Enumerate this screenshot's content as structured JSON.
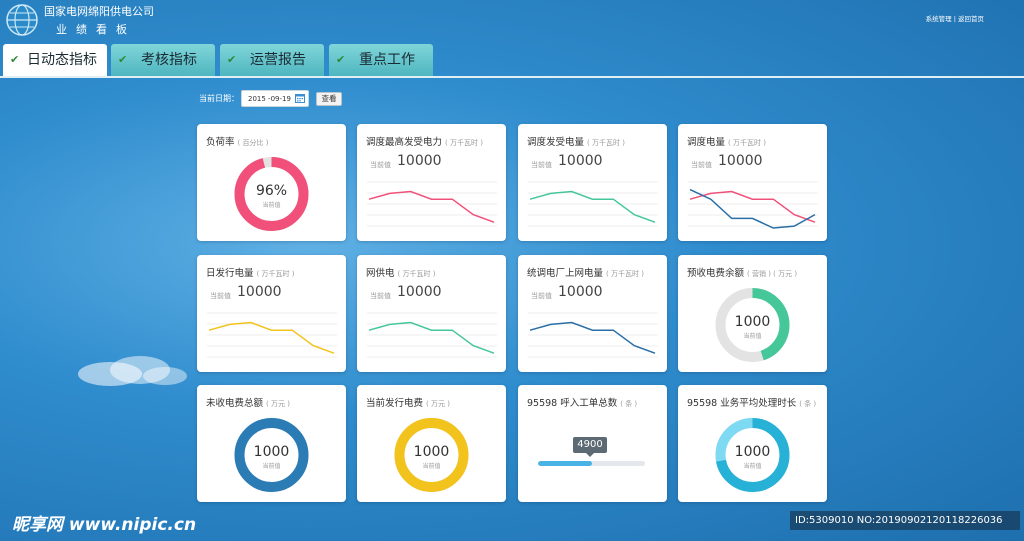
{
  "header": {
    "company": "国家电网绵阳供电公司",
    "subtitle": "业绩看板",
    "links": [
      "系统管理",
      "返回首页"
    ],
    "separator": "|",
    "logo_icon": "globe-logo-icon"
  },
  "tabs": [
    {
      "label": "日动态指标",
      "active": true
    },
    {
      "label": "考核指标",
      "active": false
    },
    {
      "label": "运营报告",
      "active": false
    },
    {
      "label": "重点工作",
      "active": false
    }
  ],
  "date_filter": {
    "label": "当前日期：",
    "value": "2015 -09-19",
    "button": "查看"
  },
  "colors": {
    "pink": "#f0507a",
    "teal": "#45c79a",
    "navy": "#2a6ea6",
    "yellow": "#f2c31c",
    "gray": "#e3e3e3",
    "blue": "#2b7bb5",
    "light_blue": "#4ab3e5",
    "cyan_dark": "#27b1d6",
    "cyan_light": "#7ddaf2"
  },
  "cards": [
    {
      "title": "负荷率",
      "unit": "( 百分比 )",
      "type": "donut",
      "value": "96%",
      "value_label": "当前值",
      "percent": 0.96,
      "color": "pink"
    },
    {
      "title": "调度最高发受电力",
      "unit": "( 万千瓦时 )",
      "type": "line",
      "cur_label": "当前值",
      "cur_value": "10000",
      "series": [
        {
          "values": [
            10,
            7,
            6,
            10,
            10,
            18,
            22
          ],
          "color": "pink"
        }
      ]
    },
    {
      "title": "调度发受电量",
      "unit": "( 万千瓦时 )",
      "type": "line",
      "cur_label": "当前值",
      "cur_value": "10000",
      "series": [
        {
          "values": [
            10,
            7,
            6,
            10,
            10,
            18,
            22
          ],
          "color": "teal"
        }
      ]
    },
    {
      "title": "调度电量",
      "unit": "( 万千瓦时 )",
      "type": "line",
      "cur_label": "当前值",
      "cur_value": "10000",
      "series": [
        {
          "values": [
            10,
            7,
            6,
            10,
            10,
            18,
            22
          ],
          "color": "pink"
        },
        {
          "values": [
            5,
            10,
            20,
            20,
            25,
            24,
            18
          ],
          "color": "navy"
        }
      ]
    },
    {
      "title": "日发行电量",
      "unit": "( 万千瓦时 )",
      "type": "line",
      "cur_label": "当前值",
      "cur_value": "10000",
      "series": [
        {
          "values": [
            10,
            7,
            6,
            10,
            10,
            18,
            22
          ],
          "color": "yellow"
        }
      ]
    },
    {
      "title": "网供电",
      "unit": "( 万千瓦时 )",
      "type": "line",
      "cur_label": "当前值",
      "cur_value": "10000",
      "series": [
        {
          "values": [
            10,
            7,
            6,
            10,
            10,
            18,
            22
          ],
          "color": "teal"
        }
      ]
    },
    {
      "title": "统调电厂上网电量",
      "unit": "( 万千瓦时 )",
      "type": "line",
      "cur_label": "当前值",
      "cur_value": "10000",
      "series": [
        {
          "values": [
            10,
            7,
            6,
            10,
            10,
            18,
            22
          ],
          "color": "navy"
        }
      ]
    },
    {
      "title": "预收电费余额",
      "unit": "( 营销 ) ( 万元 )",
      "type": "donut",
      "value": "1000",
      "value_label": "当前值",
      "percent": 0.45,
      "color": "teal"
    },
    {
      "title": "未收电费总额",
      "unit": "( 万元 )",
      "type": "donut",
      "value": "1000",
      "value_label": "当前值",
      "percent": 1.0,
      "color": "blue"
    },
    {
      "title": "当前发行电费",
      "unit": "( 万元 )",
      "type": "donut",
      "value": "1000",
      "value_label": "当前值",
      "percent": 1.0,
      "color": "yellow"
    },
    {
      "title": "95598 呼入工单总数",
      "unit": "( 条 )",
      "type": "progress",
      "value": "4900",
      "percent": 0.5,
      "color": "light_blue"
    },
    {
      "title": "95598 业务平均处理时长",
      "unit": "( 条 )",
      "type": "donut2",
      "value": "1000",
      "value_label": "当前值",
      "percent": 0.72,
      "color": "cyan_dark",
      "color2": "cyan_light"
    }
  ],
  "watermark": {
    "brand": "昵享网 www.nipic.cn",
    "id_text": "ID:5309010 NO:20190902120118226036"
  }
}
